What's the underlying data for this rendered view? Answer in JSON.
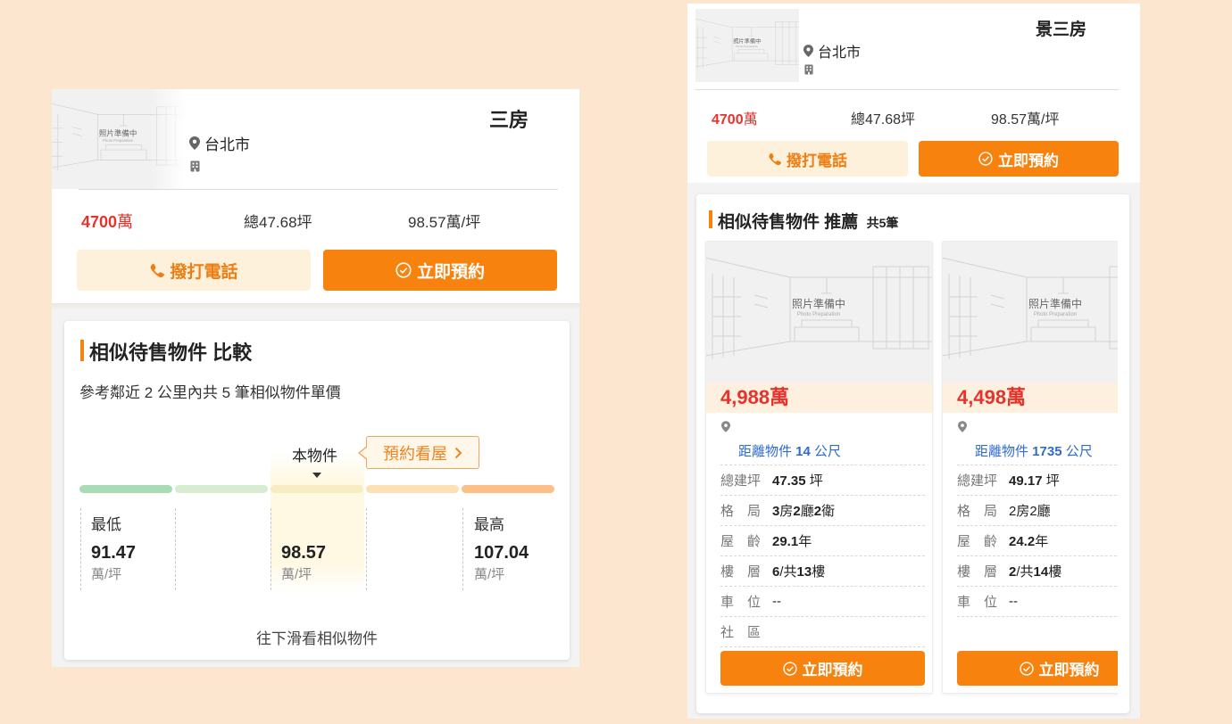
{
  "common": {
    "photo_text": "照片準備中",
    "photo_text_en": "Photo Preparation",
    "call_label": "撥打電話",
    "book_label": "立即預約"
  },
  "icons": {
    "location": "map-pin-icon",
    "building": "building-icon",
    "phone": "phone-icon",
    "book": "check-circle-icon",
    "tooltip_arrow": "chevron-right-icon"
  },
  "colors": {
    "accent": "#f7820e",
    "price_red": "#e8322b",
    "link_blue": "#2f6bd1",
    "call_bg": "#fef1dc",
    "page_bg": "#fde6cf"
  },
  "left": {
    "listing": {
      "title_fragment": "三房",
      "city": "台北市",
      "price": "4700",
      "price_unit": "萬",
      "total_area": "總47.68坪",
      "unit_price": "98.57萬/坪"
    },
    "compare": {
      "title": "相似待售物件 比較",
      "subtitle": "參考鄰近 2 公里內共 5 筆相似物件單價",
      "current_label": "本物件",
      "tooltip_label": "預約看屋",
      "segment_colors": [
        "#a9dcb4",
        "#d6edd2",
        "#f8ecc2",
        "#fde0b4",
        "#fcbf86"
      ],
      "current_segment": 3,
      "min": {
        "label": "最低",
        "value": "91.47",
        "unit": "萬/坪"
      },
      "current": {
        "value": "98.57",
        "unit": "萬/坪"
      },
      "max": {
        "label": "最高",
        "value": "107.04",
        "unit": "萬/坪"
      },
      "footer": "往下滑看相似物件"
    }
  },
  "right": {
    "listing": {
      "title_fragment": "景三房",
      "city": "台北市",
      "price": "4700",
      "price_unit": "萬",
      "total_area": "總47.68坪",
      "unit_price": "98.57萬/坪"
    },
    "recommend": {
      "title": "相似待售物件 推薦",
      "count_prefix": "共",
      "count": "5",
      "count_suffix": "筆",
      "cards": [
        {
          "price": "4,988萬",
          "distance_prefix": "距離物件 ",
          "distance_value": "14",
          "distance_unit": " 公尺",
          "rows": [
            {
              "label": "總建坪",
              "parts": [
                {
                  "t": "47.35",
                  "b": true
                },
                {
                  "t": " 坪"
                }
              ]
            },
            {
              "label": "格　局",
              "parts": [
                {
                  "t": "3",
                  "b": true
                },
                {
                  "t": "房"
                },
                {
                  "t": "2",
                  "b": true
                },
                {
                  "t": "廳"
                },
                {
                  "t": "2",
                  "b": true
                },
                {
                  "t": "衛"
                }
              ]
            },
            {
              "label": "屋　齡",
              "parts": [
                {
                  "t": "29.1",
                  "b": true
                },
                {
                  "t": "年"
                }
              ]
            },
            {
              "label": "樓　層",
              "parts": [
                {
                  "t": "6",
                  "b": true
                },
                {
                  "t": "/共"
                },
                {
                  "t": "13",
                  "b": true
                },
                {
                  "t": "樓"
                }
              ]
            },
            {
              "label": "車　位",
              "parts": [
                {
                  "t": "--"
                }
              ]
            },
            {
              "label": "社　區",
              "parts": []
            }
          ]
        },
        {
          "price": "4,498萬",
          "distance_prefix": "距離物件 ",
          "distance_value": "1735",
          "distance_unit": " 公尺",
          "rows": [
            {
              "label": "總建坪",
              "parts": [
                {
                  "t": "49.17",
                  "b": true
                },
                {
                  "t": " 坪"
                }
              ]
            },
            {
              "label": "格　局",
              "parts": [
                {
                  "t": "2房2廳"
                }
              ]
            },
            {
              "label": "屋　齡",
              "parts": [
                {
                  "t": "24.2",
                  "b": true
                },
                {
                  "t": "年"
                }
              ]
            },
            {
              "label": "樓　層",
              "parts": [
                {
                  "t": "2",
                  "b": true
                },
                {
                  "t": "/共"
                },
                {
                  "t": "14",
                  "b": true
                },
                {
                  "t": "樓"
                }
              ]
            },
            {
              "label": "車　位",
              "parts": [
                {
                  "t": "--"
                }
              ]
            }
          ]
        }
      ]
    }
  }
}
